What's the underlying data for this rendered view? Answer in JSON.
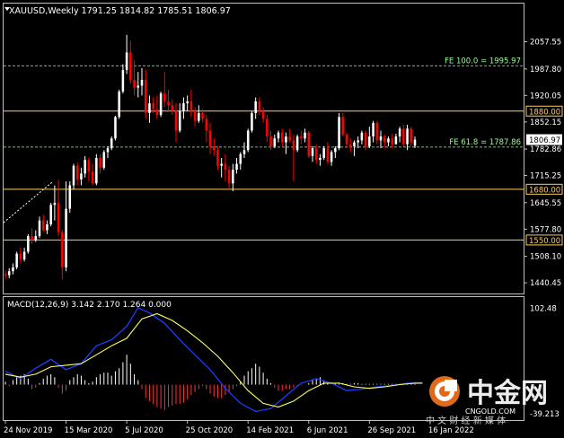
{
  "header": {
    "main_title": "XAUUSD,Weekly  1791.25 1814.82 1785.51 1806.97",
    "macd_title": "MACD(12,26,9) 3.142 2.170 1.264 0.000"
  },
  "colors": {
    "background": "#000000",
    "frame": "#c0c0c0",
    "up_candle": "#ffffff",
    "down_candle": "#ff0000",
    "level_line": "#ffcc66",
    "fe_line": "#99ff99",
    "macd_line": "#1e3cff",
    "signal_line": "#ffff66",
    "hist_up": "#ffffff",
    "hist_down": "#ff3333",
    "grid_text": "#ffffff"
  },
  "chart_data": [
    {
      "type": "candlestick",
      "symbol": "XAUUSD",
      "timeframe": "Weekly",
      "last": {
        "open": 1791.25,
        "high": 1814.82,
        "low": 1785.51,
        "close": 1806.97
      },
      "ylim": [
        1420,
        2100
      ],
      "y_ticks": [
        "2057.55",
        "1987.80",
        "1920.05",
        "1852.15",
        "1782.86",
        "1715.25",
        "1645.55",
        "1577.80",
        "1508.10",
        "1440.45"
      ],
      "x_ticks": [
        "24 Nov 2019",
        "15 Mar 2020",
        "5 Jul 2020",
        "25 Oct 2020",
        "14 Feb 2021",
        "6 Jun 2021",
        "26 Sep 2021",
        "16 Jan 2022"
      ],
      "x_tick_index": [
        0,
        16,
        32,
        48,
        64,
        80,
        96,
        112
      ],
      "price_label": "1806.97",
      "levels": [
        {
          "value": 1880.0,
          "label": "1880.00"
        },
        {
          "value": 1680.0,
          "label": "1680.00"
        },
        {
          "value": 1550.0,
          "label": "1550.00"
        }
      ],
      "fibo": [
        {
          "value": 1995.97,
          "label": "FE 100.0 = 1995.97"
        },
        {
          "value": 1787.86,
          "label": "FE 61.8 = 1787.86"
        }
      ],
      "candles": [
        [
          1463,
          1472,
          1450,
          1460
        ],
        [
          1460,
          1478,
          1452,
          1470
        ],
        [
          1470,
          1490,
          1462,
          1480
        ],
        [
          1480,
          1520,
          1475,
          1515
        ],
        [
          1515,
          1530,
          1490,
          1500
        ],
        [
          1500,
          1530,
          1495,
          1520
        ],
        [
          1520,
          1565,
          1515,
          1560
        ],
        [
          1560,
          1580,
          1540,
          1550
        ],
        [
          1550,
          1575,
          1545,
          1560
        ],
        [
          1560,
          1610,
          1555,
          1600
        ],
        [
          1600,
          1615,
          1570,
          1575
        ],
        [
          1575,
          1600,
          1565,
          1590
        ],
        [
          1590,
          1645,
          1585,
          1640
        ],
        [
          1640,
          1690,
          1600,
          1645
        ],
        [
          1645,
          1704,
          1560,
          1570
        ],
        [
          1570,
          1575,
          1450,
          1480
        ],
        [
          1480,
          1700,
          1470,
          1630
        ],
        [
          1630,
          1700,
          1620,
          1690
        ],
        [
          1690,
          1745,
          1680,
          1740
        ],
        [
          1740,
          1748,
          1690,
          1705
        ],
        [
          1705,
          1735,
          1690,
          1720
        ],
        [
          1720,
          1765,
          1710,
          1755
        ],
        [
          1755,
          1762,
          1700,
          1725
        ],
        [
          1725,
          1745,
          1690,
          1695
        ],
        [
          1695,
          1770,
          1690,
          1760
        ],
        [
          1760,
          1770,
          1720,
          1735
        ],
        [
          1735,
          1780,
          1730,
          1775
        ],
        [
          1775,
          1790,
          1760,
          1785
        ],
        [
          1785,
          1815,
          1780,
          1810
        ],
        [
          1810,
          1868,
          1805,
          1865
        ],
        [
          1865,
          1935,
          1860,
          1930
        ],
        [
          1930,
          2000,
          1925,
          1985
        ],
        [
          1985,
          2075,
          1975,
          2030
        ],
        [
          2030,
          2060,
          1950,
          1960
        ],
        [
          1960,
          2010,
          1920,
          1940
        ],
        [
          1940,
          1980,
          1915,
          1945
        ],
        [
          1945,
          1990,
          1920,
          1960
        ],
        [
          1960,
          1985,
          1860,
          1875
        ],
        [
          1875,
          1920,
          1850,
          1900
        ],
        [
          1900,
          1915,
          1875,
          1885
        ],
        [
          1885,
          1920,
          1860,
          1870
        ],
        [
          1870,
          1930,
          1865,
          1925
        ],
        [
          1925,
          1980,
          1890,
          1905
        ],
        [
          1905,
          1935,
          1880,
          1895
        ],
        [
          1895,
          1910,
          1870,
          1880
        ],
        [
          1880,
          1900,
          1800,
          1830
        ],
        [
          1830,
          1900,
          1825,
          1880
        ],
        [
          1880,
          1915,
          1860,
          1900
        ],
        [
          1900,
          1920,
          1880,
          1905
        ],
        [
          1905,
          1935,
          1865,
          1880
        ],
        [
          1880,
          1890,
          1840,
          1855
        ],
        [
          1855,
          1895,
          1850,
          1875
        ],
        [
          1875,
          1885,
          1850,
          1860
        ],
        [
          1860,
          1870,
          1800,
          1830
        ],
        [
          1830,
          1850,
          1770,
          1790
        ],
        [
          1790,
          1810,
          1765,
          1780
        ],
        [
          1780,
          1790,
          1730,
          1740
        ],
        [
          1740,
          1760,
          1710,
          1745
        ],
        [
          1745,
          1770,
          1700,
          1730
        ],
        [
          1730,
          1740,
          1680,
          1695
        ],
        [
          1695,
          1745,
          1675,
          1730
        ],
        [
          1730,
          1760,
          1720,
          1745
        ],
        [
          1745,
          1775,
          1730,
          1770
        ],
        [
          1770,
          1800,
          1760,
          1780
        ],
        [
          1780,
          1835,
          1775,
          1830
        ],
        [
          1830,
          1880,
          1825,
          1875
        ],
        [
          1875,
          1915,
          1860,
          1905
        ],
        [
          1905,
          1915,
          1870,
          1880
        ],
        [
          1880,
          1890,
          1850,
          1860
        ],
        [
          1860,
          1870,
          1800,
          1815
        ],
        [
          1815,
          1830,
          1780,
          1790
        ],
        [
          1790,
          1820,
          1785,
          1810
        ],
        [
          1810,
          1830,
          1800,
          1825
        ],
        [
          1825,
          1835,
          1790,
          1800
        ],
        [
          1800,
          1825,
          1770,
          1815
        ],
        [
          1815,
          1835,
          1800,
          1805
        ],
        [
          1805,
          1820,
          1700,
          1780
        ],
        [
          1780,
          1820,
          1775,
          1815
        ],
        [
          1815,
          1830,
          1795,
          1810
        ],
        [
          1810,
          1835,
          1800,
          1825
        ],
        [
          1825,
          1830,
          1760,
          1765
        ],
        [
          1765,
          1790,
          1750,
          1785
        ],
        [
          1785,
          1795,
          1745,
          1755
        ],
        [
          1755,
          1770,
          1740,
          1760
        ],
        [
          1760,
          1790,
          1755,
          1785
        ],
        [
          1785,
          1800,
          1745,
          1750
        ],
        [
          1750,
          1780,
          1740,
          1775
        ],
        [
          1775,
          1790,
          1760,
          1785
        ],
        [
          1785,
          1875,
          1780,
          1865
        ],
        [
          1865,
          1875,
          1815,
          1820
        ],
        [
          1820,
          1825,
          1785,
          1795
        ],
        [
          1795,
          1810,
          1775,
          1790
        ],
        [
          1790,
          1805,
          1765,
          1800
        ],
        [
          1800,
          1815,
          1785,
          1805
        ],
        [
          1805,
          1830,
          1795,
          1825
        ],
        [
          1825,
          1830,
          1780,
          1790
        ],
        [
          1790,
          1840,
          1785,
          1815
        ],
        [
          1815,
          1855,
          1800,
          1850
        ],
        [
          1850,
          1855,
          1795,
          1805
        ],
        [
          1805,
          1830,
          1785,
          1815
        ],
        [
          1815,
          1820,
          1785,
          1800
        ],
        [
          1800,
          1815,
          1790,
          1810
        ],
        [
          1810,
          1822,
          1785,
          1795
        ],
        [
          1795,
          1822,
          1795,
          1815
        ],
        [
          1815,
          1840,
          1800,
          1835
        ],
        [
          1835,
          1845,
          1790,
          1795
        ],
        [
          1795,
          1845,
          1780,
          1835
        ],
        [
          1835,
          1840,
          1790,
          1800
        ],
        [
          1791.25,
          1814.82,
          1785.51,
          1806.97
        ]
      ]
    },
    {
      "type": "macd",
      "params": "MACD(12,26,9)",
      "values": {
        "macd": 3.142,
        "signal": 2.17,
        "histogram": 1.264,
        "zero": 0.0
      },
      "y_ticks": [
        "102.48",
        "-39.213"
      ],
      "ylim": [
        -45,
        110
      ],
      "macd_points": [
        [
          0,
          18
        ],
        [
          4,
          8
        ],
        [
          8,
          22
        ],
        [
          12,
          34
        ],
        [
          16,
          20
        ],
        [
          20,
          28
        ],
        [
          24,
          52
        ],
        [
          28,
          60
        ],
        [
          32,
          78
        ],
        [
          35,
          103
        ],
        [
          38,
          96
        ],
        [
          42,
          82
        ],
        [
          46,
          60
        ],
        [
          50,
          40
        ],
        [
          54,
          20
        ],
        [
          58,
          -5
        ],
        [
          62,
          -25
        ],
        [
          66,
          -36
        ],
        [
          70,
          -32
        ],
        [
          74,
          -15
        ],
        [
          78,
          2
        ],
        [
          82,
          8
        ],
        [
          86,
          2
        ],
        [
          90,
          -8
        ],
        [
          94,
          -6
        ],
        [
          98,
          -3
        ],
        [
          102,
          -1
        ],
        [
          106,
          2
        ],
        [
          110,
          3
        ]
      ],
      "signal_points": [
        [
          0,
          14
        ],
        [
          4,
          10
        ],
        [
          8,
          14
        ],
        [
          12,
          24
        ],
        [
          16,
          26
        ],
        [
          20,
          28
        ],
        [
          24,
          40
        ],
        [
          28,
          52
        ],
        [
          32,
          62
        ],
        [
          36,
          88
        ],
        [
          40,
          95
        ],
        [
          44,
          86
        ],
        [
          48,
          72
        ],
        [
          52,
          56
        ],
        [
          56,
          38
        ],
        [
          60,
          16
        ],
        [
          64,
          -8
        ],
        [
          68,
          -25
        ],
        [
          72,
          -30
        ],
        [
          76,
          -22
        ],
        [
          80,
          -8
        ],
        [
          84,
          2
        ],
        [
          88,
          2
        ],
        [
          92,
          -3
        ],
        [
          96,
          -5
        ],
        [
          100,
          -3
        ],
        [
          104,
          0
        ],
        [
          108,
          2
        ],
        [
          110,
          2
        ]
      ],
      "histogram": [
        4,
        -2,
        6,
        10,
        12,
        14,
        8,
        -6,
        -4,
        2,
        8,
        12,
        14,
        10,
        -4,
        -12,
        -8,
        6,
        10,
        14,
        12,
        6,
        2,
        4,
        10,
        14,
        16,
        16,
        12,
        18,
        22,
        30,
        40,
        28,
        14,
        6,
        -6,
        -18,
        -22,
        -26,
        -30,
        -32,
        -34,
        -30,
        -28,
        -26,
        -26,
        -24,
        -20,
        -14,
        -10,
        -6,
        -2,
        -6,
        -12,
        -16,
        -18,
        -18,
        -14,
        -10,
        -6,
        -2,
        4,
        12,
        18,
        22,
        28,
        24,
        16,
        8,
        2,
        -4,
        -8,
        -8,
        -6,
        -6,
        -4,
        -2,
        -1,
        0,
        2,
        6,
        8,
        10,
        6,
        2,
        0,
        1,
        1,
        2,
        1,
        1,
        2,
        2,
        1,
        1,
        1,
        1,
        1,
        1,
        1,
        1,
        1,
        1,
        1,
        1,
        1,
        1,
        1,
        1,
        1
      ]
    }
  ],
  "watermark": {
    "brand_cn": "中金网",
    "domain": "CNGOLD.COM",
    "slogan": "中 文 财 经 新 媒 体"
  }
}
